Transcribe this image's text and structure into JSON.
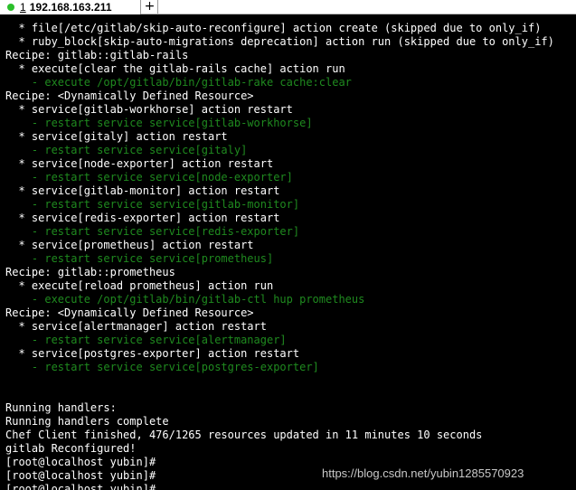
{
  "tab": {
    "number": "1",
    "host": "192.168.163.211",
    "add_label": "+",
    "status_color": "#2bbf2b"
  },
  "terminal": {
    "lines": [
      {
        "text": "  * file[/etc/gitlab/skip-auto-reconfigure] action create (skipped due to only_if)",
        "style": "normal"
      },
      {
        "text": "  * ruby_block[skip-auto-migrations deprecation] action run (skipped due to only_if)",
        "style": "normal"
      },
      {
        "text": "Recipe: gitlab::gitlab-rails",
        "style": "normal"
      },
      {
        "text": "  * execute[clear the gitlab-rails cache] action run",
        "style": "normal"
      },
      {
        "text": "    - execute /opt/gitlab/bin/gitlab-rake cache:clear",
        "style": "dim"
      },
      {
        "text": "Recipe: <Dynamically Defined Resource>",
        "style": "normal"
      },
      {
        "text": "  * service[gitlab-workhorse] action restart",
        "style": "normal"
      },
      {
        "text": "    - restart service service[gitlab-workhorse]",
        "style": "dim"
      },
      {
        "text": "  * service[gitaly] action restart",
        "style": "normal"
      },
      {
        "text": "    - restart service service[gitaly]",
        "style": "dim"
      },
      {
        "text": "  * service[node-exporter] action restart",
        "style": "normal"
      },
      {
        "text": "    - restart service service[node-exporter]",
        "style": "dim"
      },
      {
        "text": "  * service[gitlab-monitor] action restart",
        "style": "normal"
      },
      {
        "text": "    - restart service service[gitlab-monitor]",
        "style": "dim"
      },
      {
        "text": "  * service[redis-exporter] action restart",
        "style": "normal"
      },
      {
        "text": "    - restart service service[redis-exporter]",
        "style": "dim"
      },
      {
        "text": "  * service[prometheus] action restart",
        "style": "normal"
      },
      {
        "text": "    - restart service service[prometheus]",
        "style": "dim"
      },
      {
        "text": "Recipe: gitlab::prometheus",
        "style": "normal"
      },
      {
        "text": "  * execute[reload prometheus] action run",
        "style": "normal"
      },
      {
        "text": "    - execute /opt/gitlab/bin/gitlab-ctl hup prometheus",
        "style": "dim"
      },
      {
        "text": "Recipe: <Dynamically Defined Resource>",
        "style": "normal"
      },
      {
        "text": "  * service[alertmanager] action restart",
        "style": "normal"
      },
      {
        "text": "    - restart service service[alertmanager]",
        "style": "dim"
      },
      {
        "text": "  * service[postgres-exporter] action restart",
        "style": "normal"
      },
      {
        "text": "    - restart service service[postgres-exporter]",
        "style": "dim"
      },
      {
        "text": "",
        "style": "normal"
      },
      {
        "text": "",
        "style": "normal"
      },
      {
        "text": "Running handlers:",
        "style": "normal"
      },
      {
        "text": "Running handlers complete",
        "style": "normal"
      },
      {
        "text": "Chef Client finished, 476/1265 resources updated in 11 minutes 10 seconds",
        "style": "normal"
      },
      {
        "text": "gitlab Reconfigured!",
        "style": "normal"
      },
      {
        "text": "[root@localhost yubin]#",
        "style": "normal"
      },
      {
        "text": "[root@localhost yubin]#",
        "style": "normal"
      },
      {
        "text": "[root@localhost yubin]#",
        "style": "normal"
      },
      {
        "text": "[root@localhost yubin]# ",
        "style": "prompt-cursor"
      }
    ]
  },
  "watermark": "https://blog.csdn.net/yubin1285570923",
  "colors": {
    "background": "#000000",
    "text": "#ffffff",
    "dim_text": "#1f8a1f",
    "cursor": "#00d100"
  }
}
